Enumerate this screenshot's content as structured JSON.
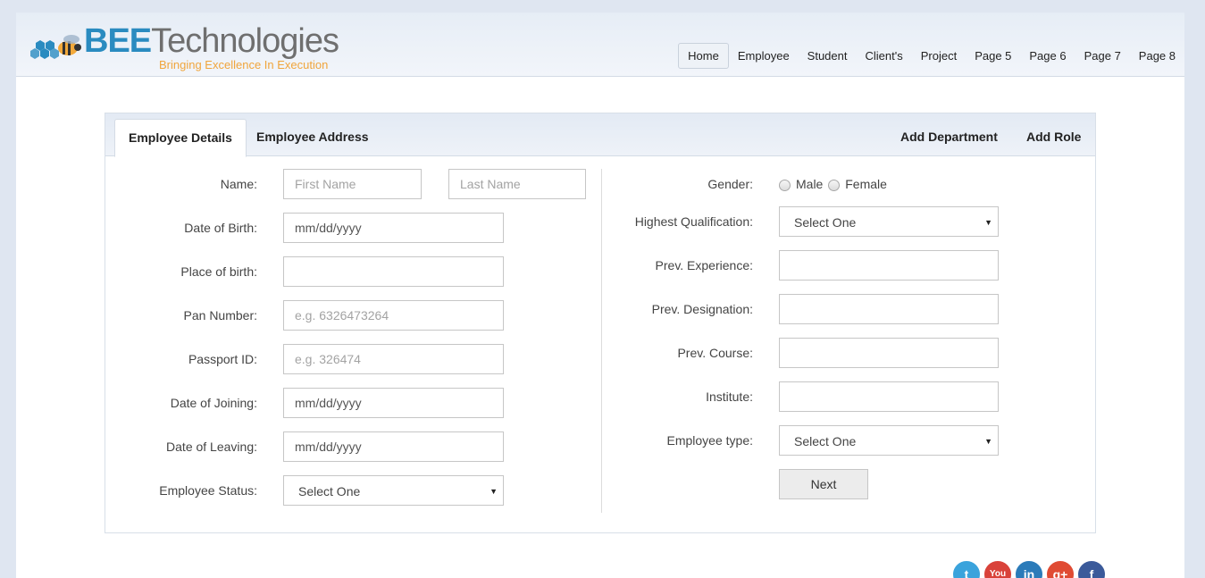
{
  "brand": {
    "name_bold": "BEE",
    "name_rest": "Technologies",
    "tagline": "Bringing Excellence In Execution",
    "colors": {
      "primary": "#2a8bc0",
      "secondary": "#6f6f6f",
      "tagline": "#f0a53c"
    }
  },
  "nav": [
    {
      "label": "Home",
      "active": true
    },
    {
      "label": "Employee"
    },
    {
      "label": "Student"
    },
    {
      "label": "Client's"
    },
    {
      "label": "Project"
    },
    {
      "label": "Page 5"
    },
    {
      "label": "Page 6"
    },
    {
      "label": "Page 7"
    },
    {
      "label": "Page 8"
    }
  ],
  "tabs": {
    "employee_details": "Employee Details",
    "employee_address": "Employee Address",
    "add_department": "Add Department",
    "add_role": "Add Role"
  },
  "form_left": {
    "name_label": "Name:",
    "first_name_placeholder": "First Name",
    "last_name_placeholder": "Last Name",
    "dob_label": "Date of Birth:",
    "dob_value": "mm/dd/yyyy",
    "pob_label": "Place of birth:",
    "pob_value": "",
    "pan_label": "Pan Number:",
    "pan_placeholder": "e.g. 6326473264",
    "passport_label": "Passport ID:",
    "passport_placeholder": "e.g. 326474",
    "doj_label": "Date of Joining:",
    "doj_value": "mm/dd/yyyy",
    "dol_label": "Date of Leaving:",
    "dol_value": "mm/dd/yyyy",
    "status_label": "Employee Status:",
    "status_value": "Select One"
  },
  "form_right": {
    "gender_label": "Gender:",
    "gender_male": "Male",
    "gender_female": "Female",
    "qualification_label": "Highest Qualification:",
    "qualification_value": "Select One",
    "experience_label": "Prev. Experience:",
    "designation_label": "Prev. Designation:",
    "course_label": "Prev. Course:",
    "institute_label": "Institute:",
    "emptype_label": "Employee type:",
    "emptype_value": "Select One",
    "next_label": "Next"
  },
  "social": [
    {
      "icon": "twitter-icon",
      "glyph": "t",
      "color": "#3aa3dc"
    },
    {
      "icon": "youtube-icon",
      "glyph": "You",
      "color": "#d9423a"
    },
    {
      "icon": "linkedin-icon",
      "glyph": "in",
      "color": "#2b7bb9"
    },
    {
      "icon": "google-plus-icon",
      "glyph": "g+",
      "color": "#e04b33"
    },
    {
      "icon": "facebook-icon",
      "glyph": "f",
      "color": "#3b5a9a"
    }
  ]
}
